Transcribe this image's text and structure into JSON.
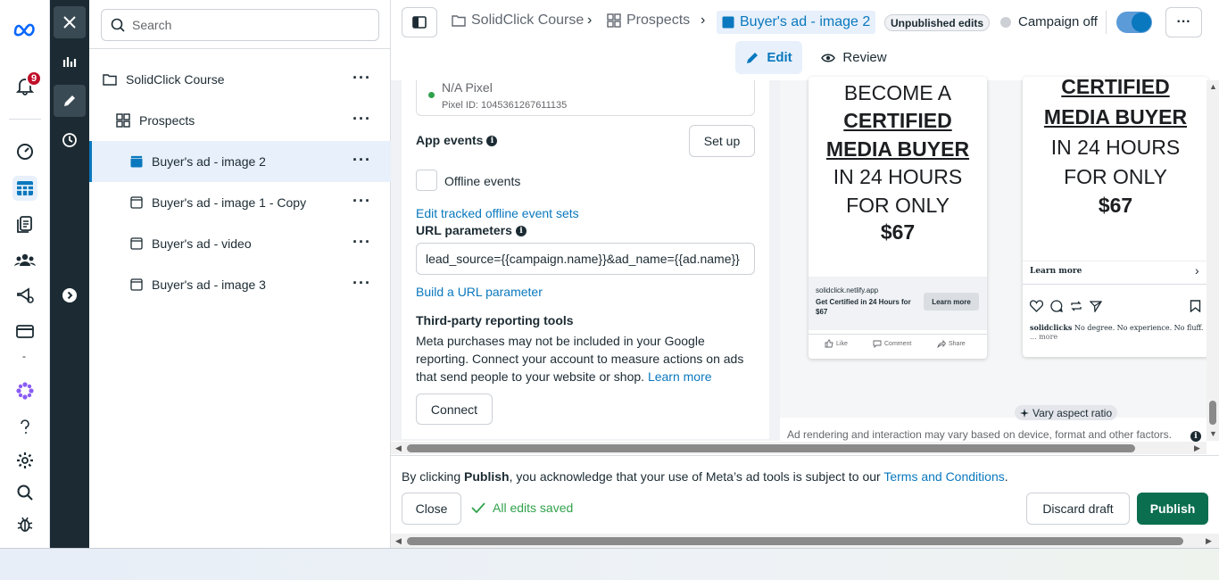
{
  "rail": {
    "notification_count": "9"
  },
  "tree": {
    "search_placeholder": "Search",
    "items": [
      {
        "label": "SolidClick Course"
      },
      {
        "label": "Prospects"
      },
      {
        "label": "Buyer's ad - image 2"
      },
      {
        "label": "Buyer's ad - image 1 - Copy"
      },
      {
        "label": "Buyer's ad - video"
      },
      {
        "label": "Buyer's ad - image 3"
      }
    ]
  },
  "topbar": {
    "breadcrumbs": [
      "SolidClick Course",
      "Prospects",
      "Buyer's ad - image 2"
    ],
    "unpublished": "Unpublished edits",
    "campaign_status": "Campaign off",
    "more": "···"
  },
  "modes": {
    "edit": "Edit",
    "review": "Review"
  },
  "settings": {
    "pixel_name": "N/A Pixel",
    "pixel_id": "Pixel ID: 1045361267611135",
    "app_events_label": "App events",
    "setup_button": "Set up",
    "offline_events_label": "Offline events",
    "edit_offline_link": "Edit tracked offline event sets",
    "url_params_label": "URL parameters",
    "url_params_value": "lead_source={{campaign.name}}&ad_name={{ad.name}}",
    "build_url_link": "Build a URL parameter",
    "third_party_title": "Third-party reporting tools",
    "third_party_text": "Meta purchases may not be included in your Google reporting. Connect your account to measure actions on ads that send people to your website or shop.",
    "learn_more": "Learn more",
    "connect_button": "Connect"
  },
  "preview": {
    "fb": {
      "line1": "BECOME A",
      "line2": "CERTIFIED",
      "line3": "MEDIA BUYER",
      "line4": "IN 24 HOURS",
      "line5": "FOR ONLY",
      "price": "$67",
      "domain": "solidclick.netlify.app",
      "headline": "Get Certified in 24 Hours for $67",
      "cta": "Learn more",
      "like": "Like",
      "comment": "Comment",
      "share": "Share"
    },
    "ig": {
      "line2": "CERTIFIED",
      "line3": "MEDIA BUYER",
      "line4": "IN 24 HOURS",
      "line5": "FOR ONLY",
      "price": "$67",
      "cta": "Learn more",
      "username": "solidclicks",
      "caption": "No degree. No experience. No fluff.",
      "more": "... more"
    },
    "vary_aspect": "Vary aspect ratio",
    "render_note": "Ad rendering and interaction may vary based on device, format and other factors."
  },
  "footer": {
    "legal_pre": "By clicking ",
    "legal_bold": "Publish",
    "legal_mid": ", you acknowledge that your use of Meta’s ad tools is subject to our ",
    "legal_link": "Terms and Conditions",
    "legal_end": ".",
    "close": "Close",
    "saved": "All edits saved",
    "discard": "Discard draft",
    "publish": "Publish"
  },
  "colors": {
    "accent": "#0a78be",
    "publish": "#0b6e4f",
    "dark_strip": "#1c2b33",
    "saved": "#31a24c"
  }
}
